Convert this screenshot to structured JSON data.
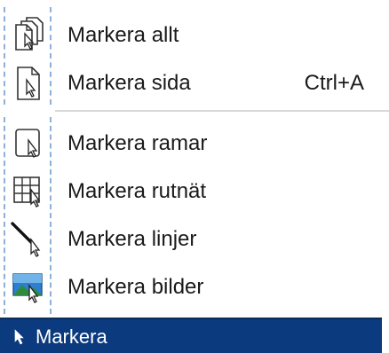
{
  "menu": {
    "items": [
      {
        "label": "Markera allt",
        "shortcut": "",
        "icon": "select-all-pages-icon"
      },
      {
        "label": "Markera sida",
        "shortcut": "Ctrl+A",
        "icon": "select-page-icon"
      },
      {
        "label": "Markera ramar",
        "shortcut": "",
        "icon": "select-frames-icon"
      },
      {
        "label": "Markera rutnät",
        "shortcut": "",
        "icon": "select-grid-icon"
      },
      {
        "label": "Markera linjer",
        "shortcut": "",
        "icon": "select-lines-icon"
      },
      {
        "label": "Markera bilder",
        "shortcut": "",
        "icon": "select-images-icon"
      }
    ]
  },
  "statusbar": {
    "label": "Markera",
    "icon": "pointer-icon",
    "background": "#0b3a7e"
  },
  "colors": {
    "dashed_guides": "#8fb0d8",
    "separator": "#d8d8d8"
  }
}
